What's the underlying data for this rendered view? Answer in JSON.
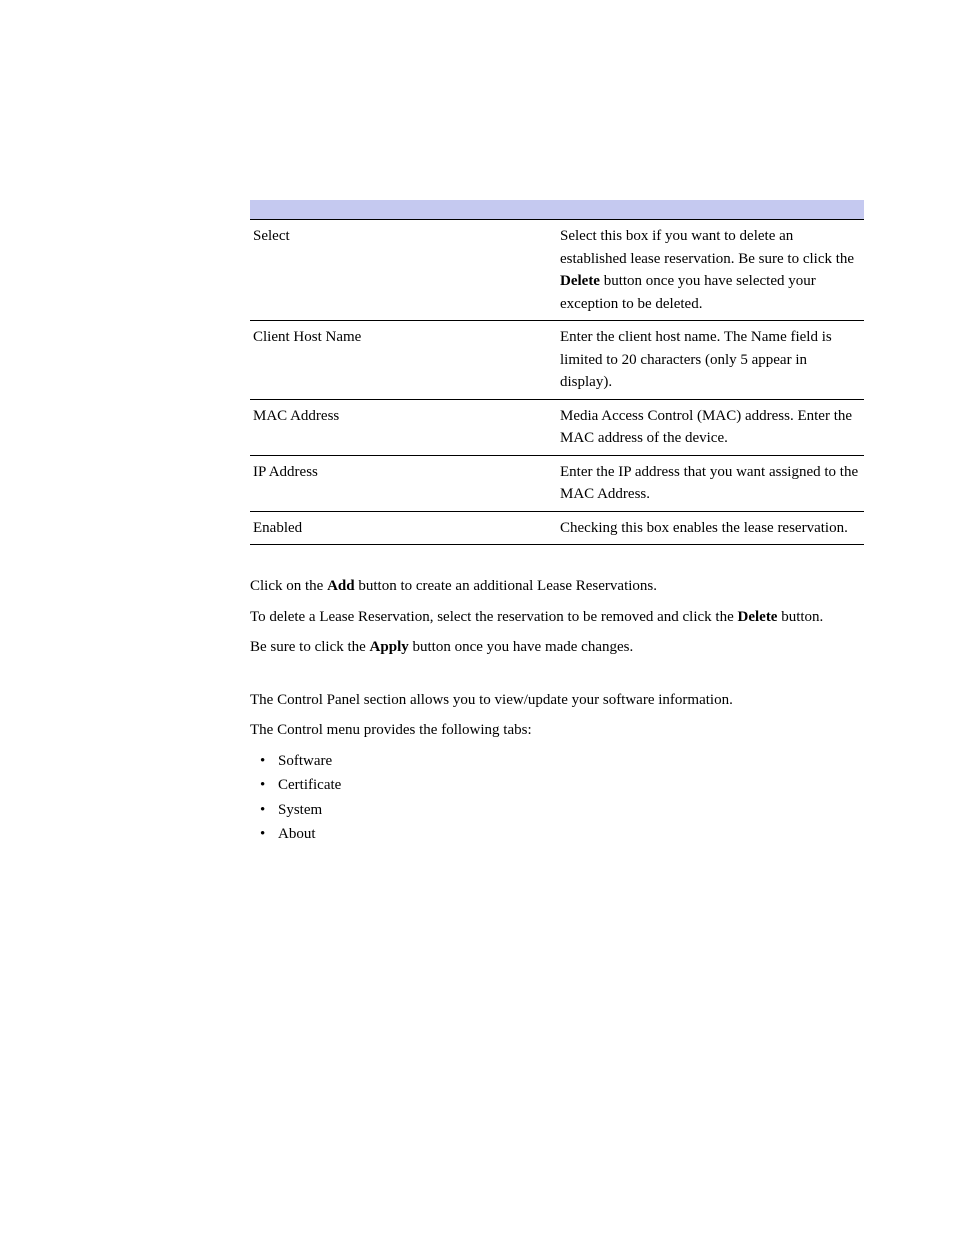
{
  "table": {
    "rows": [
      {
        "name": "Select",
        "desc_parts": [
          {
            "text": "Select this box if you want to delete an established lease reservation. Be sure to click the ",
            "bold": false
          },
          {
            "text": "Delete",
            "bold": true
          },
          {
            "text": " button once you have selected your exception to be deleted.",
            "bold": false
          }
        ]
      },
      {
        "name": "Client Host Name",
        "desc_parts": [
          {
            "text": "Enter the client host name. The Name field is limited to 20 characters (only 5 appear in display).",
            "bold": false
          }
        ]
      },
      {
        "name": "MAC Address",
        "desc_parts": [
          {
            "text": "Media Access Control (MAC) address. Enter the MAC address of the device.",
            "bold": false
          }
        ]
      },
      {
        "name": "IP Address",
        "desc_parts": [
          {
            "text": "Enter the IP address that you want assigned to the MAC Address.",
            "bold": false
          }
        ]
      },
      {
        "name": "Enabled",
        "desc_parts": [
          {
            "text": "Checking this box enables the lease reservation.",
            "bold": false
          }
        ]
      }
    ]
  },
  "para1": {
    "parts": [
      {
        "text": "Click on the ",
        "bold": false
      },
      {
        "text": "Add",
        "bold": true
      },
      {
        "text": " button to create an additional Lease Reservations.",
        "bold": false
      }
    ]
  },
  "para2": {
    "parts": [
      {
        "text": "To delete a Lease Reservation, select the reservation to be removed and click the ",
        "bold": false
      },
      {
        "text": "Delete",
        "bold": true
      },
      {
        "text": " button.",
        "bold": false
      }
    ]
  },
  "para3": {
    "parts": [
      {
        "text": "Be sure to click the ",
        "bold": false
      },
      {
        "text": "Apply",
        "bold": true
      },
      {
        "text": " button once you have made changes.",
        "bold": false
      }
    ]
  },
  "section2": {
    "p1": "The Control Panel section allows you to view/update your software information.",
    "p2": "The Control menu provides the following tabs:",
    "items": [
      "Software",
      "Certificate",
      "System",
      "About"
    ]
  }
}
